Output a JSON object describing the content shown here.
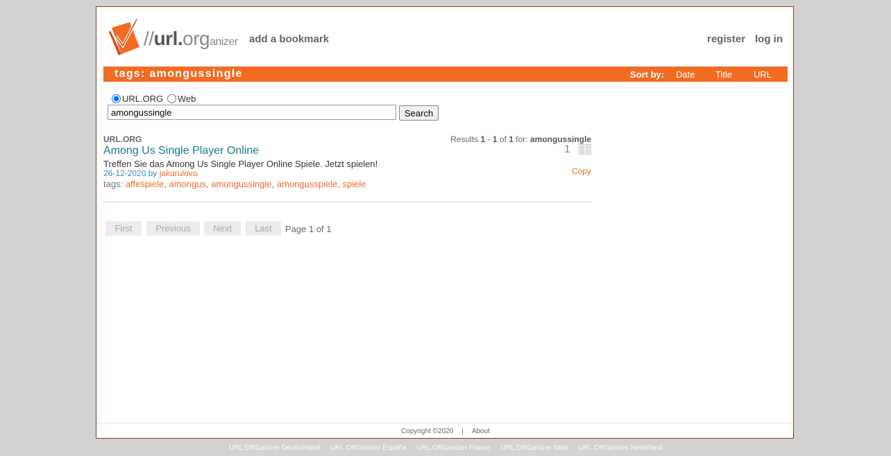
{
  "header": {
    "logo": {
      "slashes": "//",
      "url": "url.",
      "org": "org",
      "suffix": "anizer"
    },
    "add_bookmark": "add a bookmark",
    "register": "register",
    "login": "log in"
  },
  "bar": {
    "title": "tags: amongussingle",
    "sort_label": "Sort by:",
    "sort_options": [
      "Date",
      "Title",
      "URL"
    ]
  },
  "search": {
    "radio_options": [
      "URL.ORG",
      "Web"
    ],
    "selected": "URL.ORG",
    "value": "amongussingle",
    "button": "Search"
  },
  "results_info": {
    "prefix": "Results",
    "start": "1",
    "dash": "-",
    "end": "1",
    "of": "of",
    "total": "1",
    "for": "for:",
    "query": "amongussingle"
  },
  "result": {
    "source": "URL.ORG",
    "title": "Among Us Single Player Online",
    "description": "Treffen Sie das Among Us Single Player Online Spiele. Jetzt spielen!",
    "date": "26-12-2020",
    "by": "by",
    "user": "jakurulova",
    "tags_label": "tags:",
    "tags": [
      "affespiele",
      "amongus",
      "amongussingle",
      "amongusspiele",
      "spiele"
    ],
    "count": "1",
    "copy": "Copy"
  },
  "pager": {
    "first": "First",
    "previous": "Previous",
    "next": "Next",
    "last": "Last",
    "info": "Page 1 of 1"
  },
  "footer": {
    "copyright": "Copyright ©2020",
    "separator": "|",
    "about": "About",
    "sites": [
      "URL.ORGanizer Deutschland",
      "URL.ORGanizer España",
      "URL.ORGanizer France",
      "URL.ORGanizer Italia",
      "URL.ORGanizer Nederland"
    ]
  },
  "colors": {
    "accent": "#f26b22",
    "link_title": "#137a8c",
    "frame_border": "#8c3a14",
    "background": "#d2d2d2"
  }
}
